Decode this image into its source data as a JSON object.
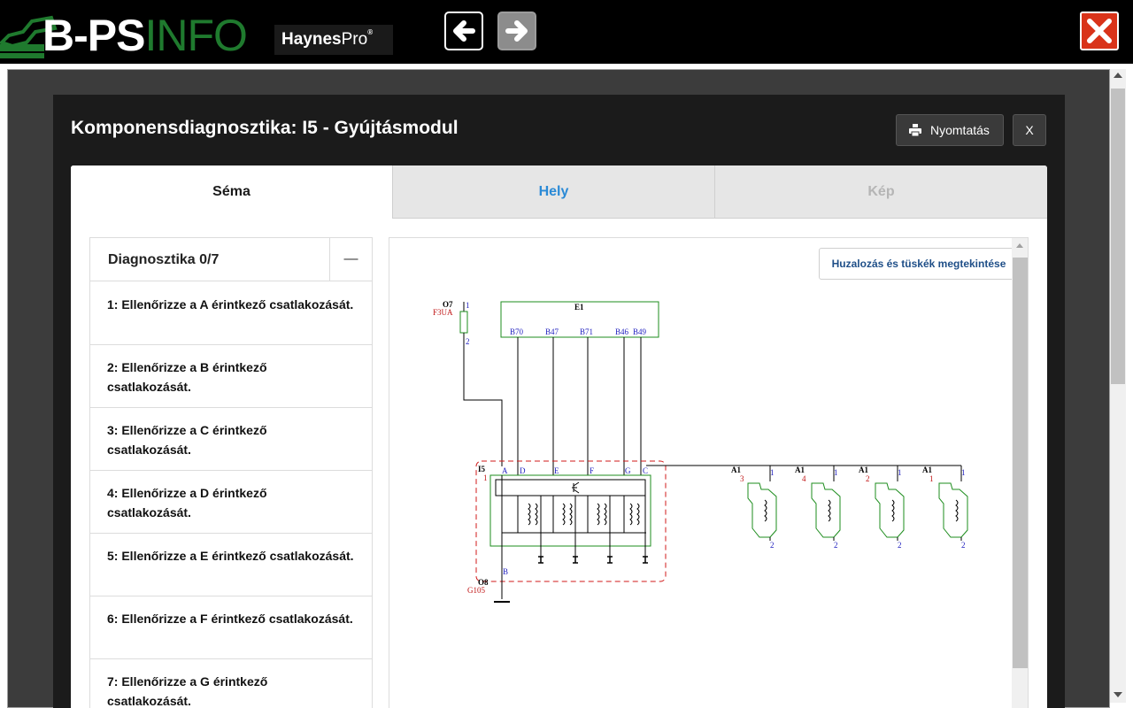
{
  "topbar": {
    "logo_b": "B",
    "logo_dash": "-",
    "logo_ps": "PS",
    "logo_info": "INFO",
    "haynes_main": "Haynes",
    "haynes_pro": "Pro",
    "haynes_reg": "®"
  },
  "modal": {
    "title": "Komponensdiagnosztika: I5 - Gyújtásmodul",
    "print_label": "Nyomtatás",
    "close_label": "X",
    "tabs": [
      {
        "label": "Séma"
      },
      {
        "label": "Hely"
      },
      {
        "label": "Kép"
      }
    ]
  },
  "diagnostics": {
    "title": "Diagnosztika 0/7",
    "collapse_label": "—",
    "items": [
      {
        "label": "1: Ellenőrizze a A érintkező csatlakozását."
      },
      {
        "label": "2: Ellenőrizze a B érintkező csatlakozását."
      },
      {
        "label": "3: Ellenőrizze a C érintkező csatlakozását."
      },
      {
        "label": "4: Ellenőrizze a D érintkező csatlakozását."
      },
      {
        "label": "5: Ellenőrizze a E érintkező csatlakozását."
      },
      {
        "label": "6: Ellenőrizze a F érintkező csatlakozását."
      },
      {
        "label": "7: Ellenőrizze a G érintkező csatlakozását."
      }
    ]
  },
  "viewer": {
    "wiring_button": "Huzalozás és tüskék megtekintése"
  },
  "schematic": {
    "fuse_name": "O7",
    "fuse_code": "F3UA",
    "fuse_pin_top": "1",
    "fuse_pin_bottom": "2",
    "ecu_name": "E1",
    "ecu_pins": [
      "B70",
      "B47",
      "B71",
      "B46",
      "B49"
    ],
    "module_name": "I5",
    "module_num": "1",
    "module_pins": [
      "A",
      "D",
      "E",
      "F",
      "G",
      "C"
    ],
    "module_pin_bottom": "B",
    "ground_name": "O8",
    "ground_code": "G105",
    "plugs": [
      {
        "name": "A1",
        "num": "3",
        "pin_top": "1",
        "pin_bottom": "2"
      },
      {
        "name": "A1",
        "num": "4",
        "pin_top": "1",
        "pin_bottom": "2"
      },
      {
        "name": "A1",
        "num": "2",
        "pin_top": "1",
        "pin_bottom": "2"
      },
      {
        "name": "A1",
        "num": "1",
        "pin_top": "1",
        "pin_bottom": "2"
      }
    ],
    "colors": {
      "wire": "#000000",
      "pin_label": "#1f1fbf",
      "code_label": "#c01515",
      "plug_outline": "#1c8c1c",
      "boundary": "#d01a1a"
    }
  },
  "colors": {
    "topbar_bg": "#000000",
    "close_red": "#d9331a",
    "link_blue": "#2a8ad6",
    "modal_bg": "#1b1b1b"
  }
}
